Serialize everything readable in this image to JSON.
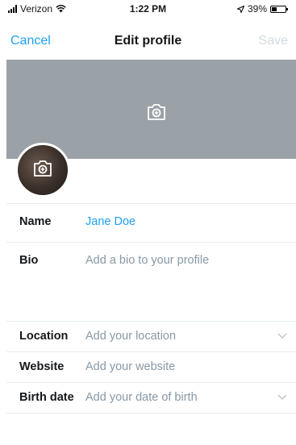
{
  "status_bar": {
    "carrier": "Verizon",
    "time": "1:22 PM",
    "battery": "39%",
    "battery_level": 0.39
  },
  "navbar": {
    "cancel_label": "Cancel",
    "title": "Edit profile",
    "save_label": "Save"
  },
  "colors": {
    "accent": "#1da1f2",
    "header_bg": "#9aa1a7",
    "disabled": "#d2dbe0",
    "placeholder": "#8899a6"
  },
  "header": {
    "icon": "camera-plus-icon"
  },
  "avatar": {
    "icon": "camera-plus-icon"
  },
  "fields": {
    "name": {
      "label": "Name",
      "value": "Jane Doe"
    },
    "bio": {
      "label": "Bio",
      "placeholder": "Add a bio to your profile"
    },
    "location": {
      "label": "Location",
      "placeholder": "Add your location",
      "icon": "chevron-down-icon"
    },
    "website": {
      "label": "Website",
      "placeholder": "Add your website"
    },
    "birth_date": {
      "label": "Birth date",
      "placeholder": "Add your date of birth",
      "icon": "chevron-down-icon"
    }
  }
}
